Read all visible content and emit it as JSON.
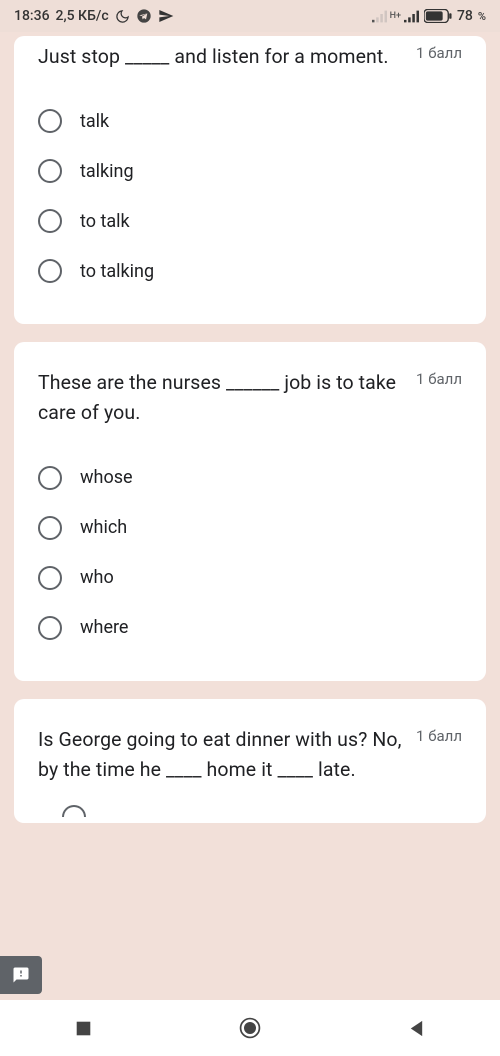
{
  "status": {
    "time": "18:36",
    "data_rate": "2,5 КБ/с",
    "battery_pct": "78",
    "battery_unit": "%"
  },
  "questions": [
    {
      "text": "Just stop _____ and listen for a moment.",
      "points": "1 балл",
      "options": [
        "talk",
        "talking",
        "to talk",
        "to talking"
      ]
    },
    {
      "text": "These are the nurses ______ job is to take care of you.",
      "points": "1 балл",
      "options": [
        "whose",
        "which",
        "who",
        "where"
      ]
    },
    {
      "text": "Is George going to eat dinner with us? No, by the time he ____ home it ____ late.",
      "points": "1 балл",
      "options": []
    }
  ]
}
